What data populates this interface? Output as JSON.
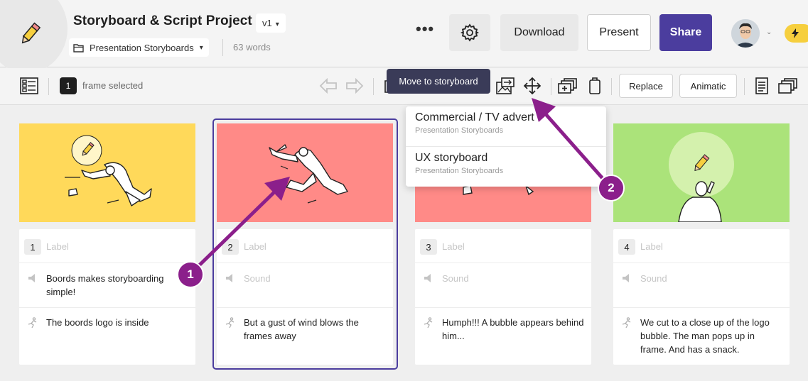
{
  "header": {
    "title": "Storyboard & Script Project",
    "version": "v1",
    "folder": "Presentation Storyboards",
    "word_count": "63 words",
    "download_label": "Download",
    "present_label": "Present",
    "share_label": "Share"
  },
  "toolbar": {
    "selected_count": "1",
    "selected_label": "frame selected",
    "replace_label": "Replace",
    "animatic_label": "Animatic",
    "tooltip": "Move to storyboard"
  },
  "dropdown": {
    "items": [
      {
        "title": "Commercial / TV advert",
        "subtitle": "Presentation Storyboards"
      },
      {
        "title": "UX storyboard",
        "subtitle": "Presentation Storyboards"
      }
    ]
  },
  "frames": [
    {
      "number": "1",
      "label_placeholder": "Label",
      "sound": "Boords makes storyboarding simple!",
      "action": "The boords logo is inside",
      "bg": "#ffd95a"
    },
    {
      "number": "2",
      "label_placeholder": "Label",
      "sound_placeholder": "Sound",
      "action": "But a gust of wind blows the frames away",
      "bg": "#ff8a87"
    },
    {
      "number": "3",
      "label_placeholder": "Label",
      "sound_placeholder": "Sound",
      "action": "Humph!!! A bubble appears behind him...",
      "bg": "#ff8a87"
    },
    {
      "number": "4",
      "label_placeholder": "Label",
      "sound_placeholder": "Sound",
      "action": "We cut to a close up of the logo bubble. The man pops up in frame. And has a snack.",
      "bg": "#abe37a"
    }
  ],
  "annotations": [
    {
      "number": "1"
    },
    {
      "number": "2"
    }
  ],
  "colors": {
    "accent": "#4b3d9e",
    "annotation": "#8b1f8b",
    "bolt": "#f6cf3e"
  }
}
